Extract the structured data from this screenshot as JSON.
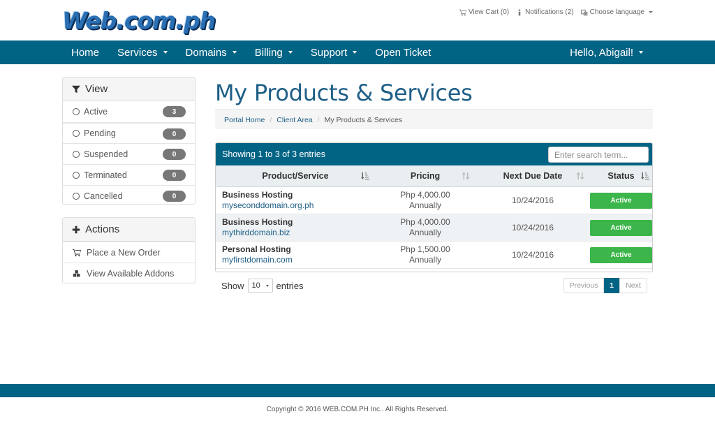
{
  "brand": {
    "logo_text": "Web.com.ph"
  },
  "toplinks": {
    "cart": "View Cart (0)",
    "notifications": "Notifications (2)",
    "language": "Choose language"
  },
  "nav": {
    "items": [
      {
        "label": "Home",
        "dropdown": false
      },
      {
        "label": "Services",
        "dropdown": true
      },
      {
        "label": "Domains",
        "dropdown": true
      },
      {
        "label": "Billing",
        "dropdown": true
      },
      {
        "label": "Support",
        "dropdown": true
      },
      {
        "label": "Open Ticket",
        "dropdown": false
      }
    ],
    "user_greeting": "Hello, Abigail!"
  },
  "sidebar": {
    "view_heading": "View",
    "filters": [
      {
        "label": "Active",
        "count": "3"
      },
      {
        "label": "Pending",
        "count": "0"
      },
      {
        "label": "Suspended",
        "count": "0"
      },
      {
        "label": "Terminated",
        "count": "0"
      },
      {
        "label": "Cancelled",
        "count": "0"
      }
    ],
    "actions_heading": "Actions",
    "actions": [
      {
        "label": "Place a New Order",
        "icon": "cart-icon"
      },
      {
        "label": "View Available Addons",
        "icon": "cubes-icon"
      }
    ]
  },
  "main": {
    "title": "My Products & Services",
    "breadcrumb": [
      "Portal Home",
      "Client Area",
      "My Products & Services"
    ],
    "table": {
      "info": "Showing 1 to 3 of 3 entries",
      "search_placeholder": "Enter search term...",
      "columns": [
        "Product/Service",
        "Pricing",
        "Next Due Date",
        "Status"
      ],
      "rows": [
        {
          "product": "Business Hosting",
          "domain": "myseconddomain.org.ph",
          "price": "Php 4,000.00",
          "cycle": "Annually",
          "due": "10/24/2016",
          "status": "Active"
        },
        {
          "product": "Business Hosting",
          "domain": "mythirddomain.biz",
          "price": "Php 4,000.00",
          "cycle": "Annually",
          "due": "10/24/2016",
          "status": "Active"
        },
        {
          "product": "Personal Hosting",
          "domain": "myfirstdomain.com",
          "price": "Php 1,500.00",
          "cycle": "Annually",
          "due": "10/24/2016",
          "status": "Active"
        }
      ]
    },
    "length": {
      "show": "Show",
      "value": "10",
      "entries": "entries"
    },
    "pagination": {
      "previous": "Previous",
      "page": "1",
      "next": "Next"
    }
  },
  "footer": {
    "copyright": "Copyright © 2016 WEB.COM.PH Inc.. All Rights Reserved."
  },
  "colors": {
    "primary": "#026485",
    "title": "#1e5f87",
    "status_active": "#3cb54a",
    "badge": "#777777"
  }
}
